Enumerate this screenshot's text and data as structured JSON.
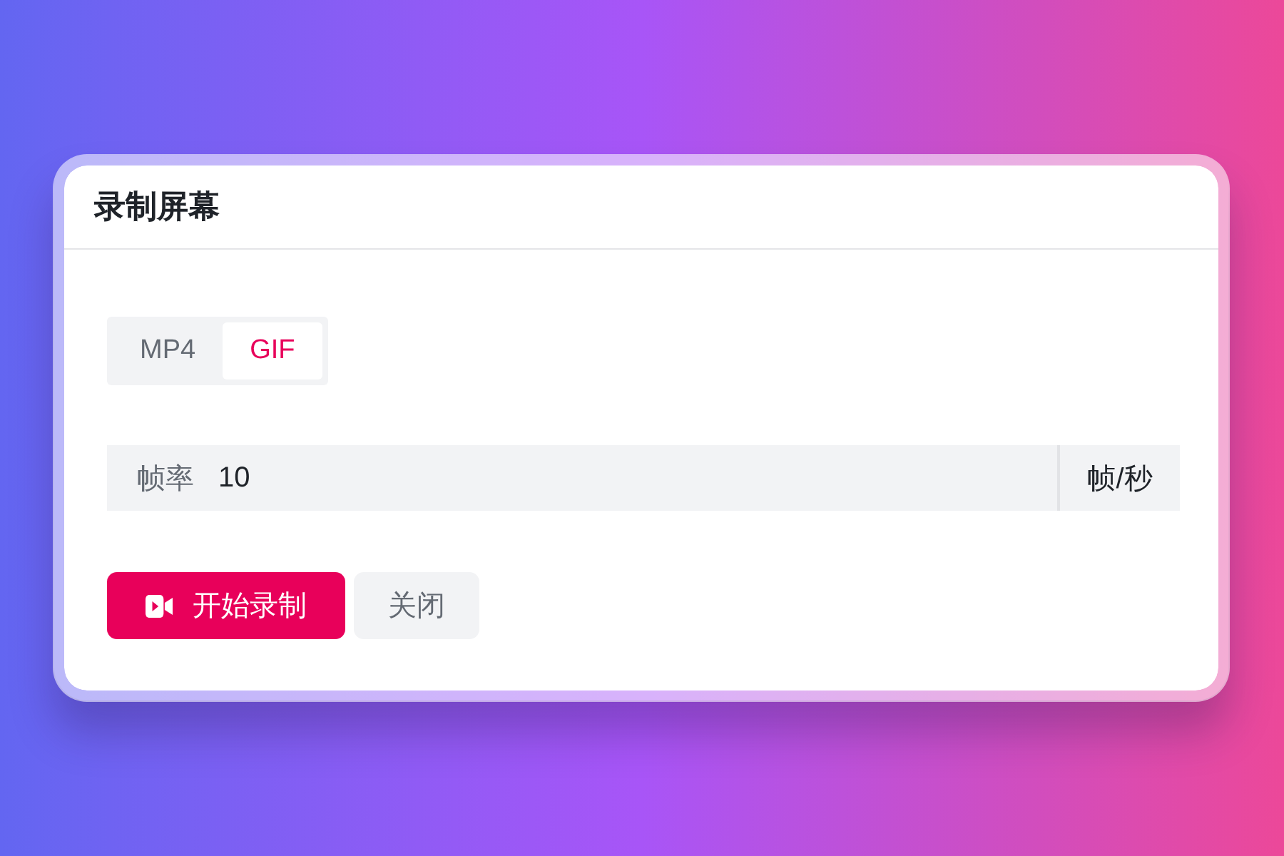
{
  "dialog": {
    "title": "录制屏幕"
  },
  "format_tabs": [
    {
      "label": "MP4",
      "selected": false
    },
    {
      "label": "GIF",
      "selected": true
    }
  ],
  "frame_rate_field": {
    "label": "帧率",
    "value": "10",
    "unit": "帧/秒"
  },
  "buttons": [
    {
      "label": "开始录制",
      "kind": "primary"
    },
    {
      "label": "关闭",
      "kind": "secondary"
    }
  ]
}
